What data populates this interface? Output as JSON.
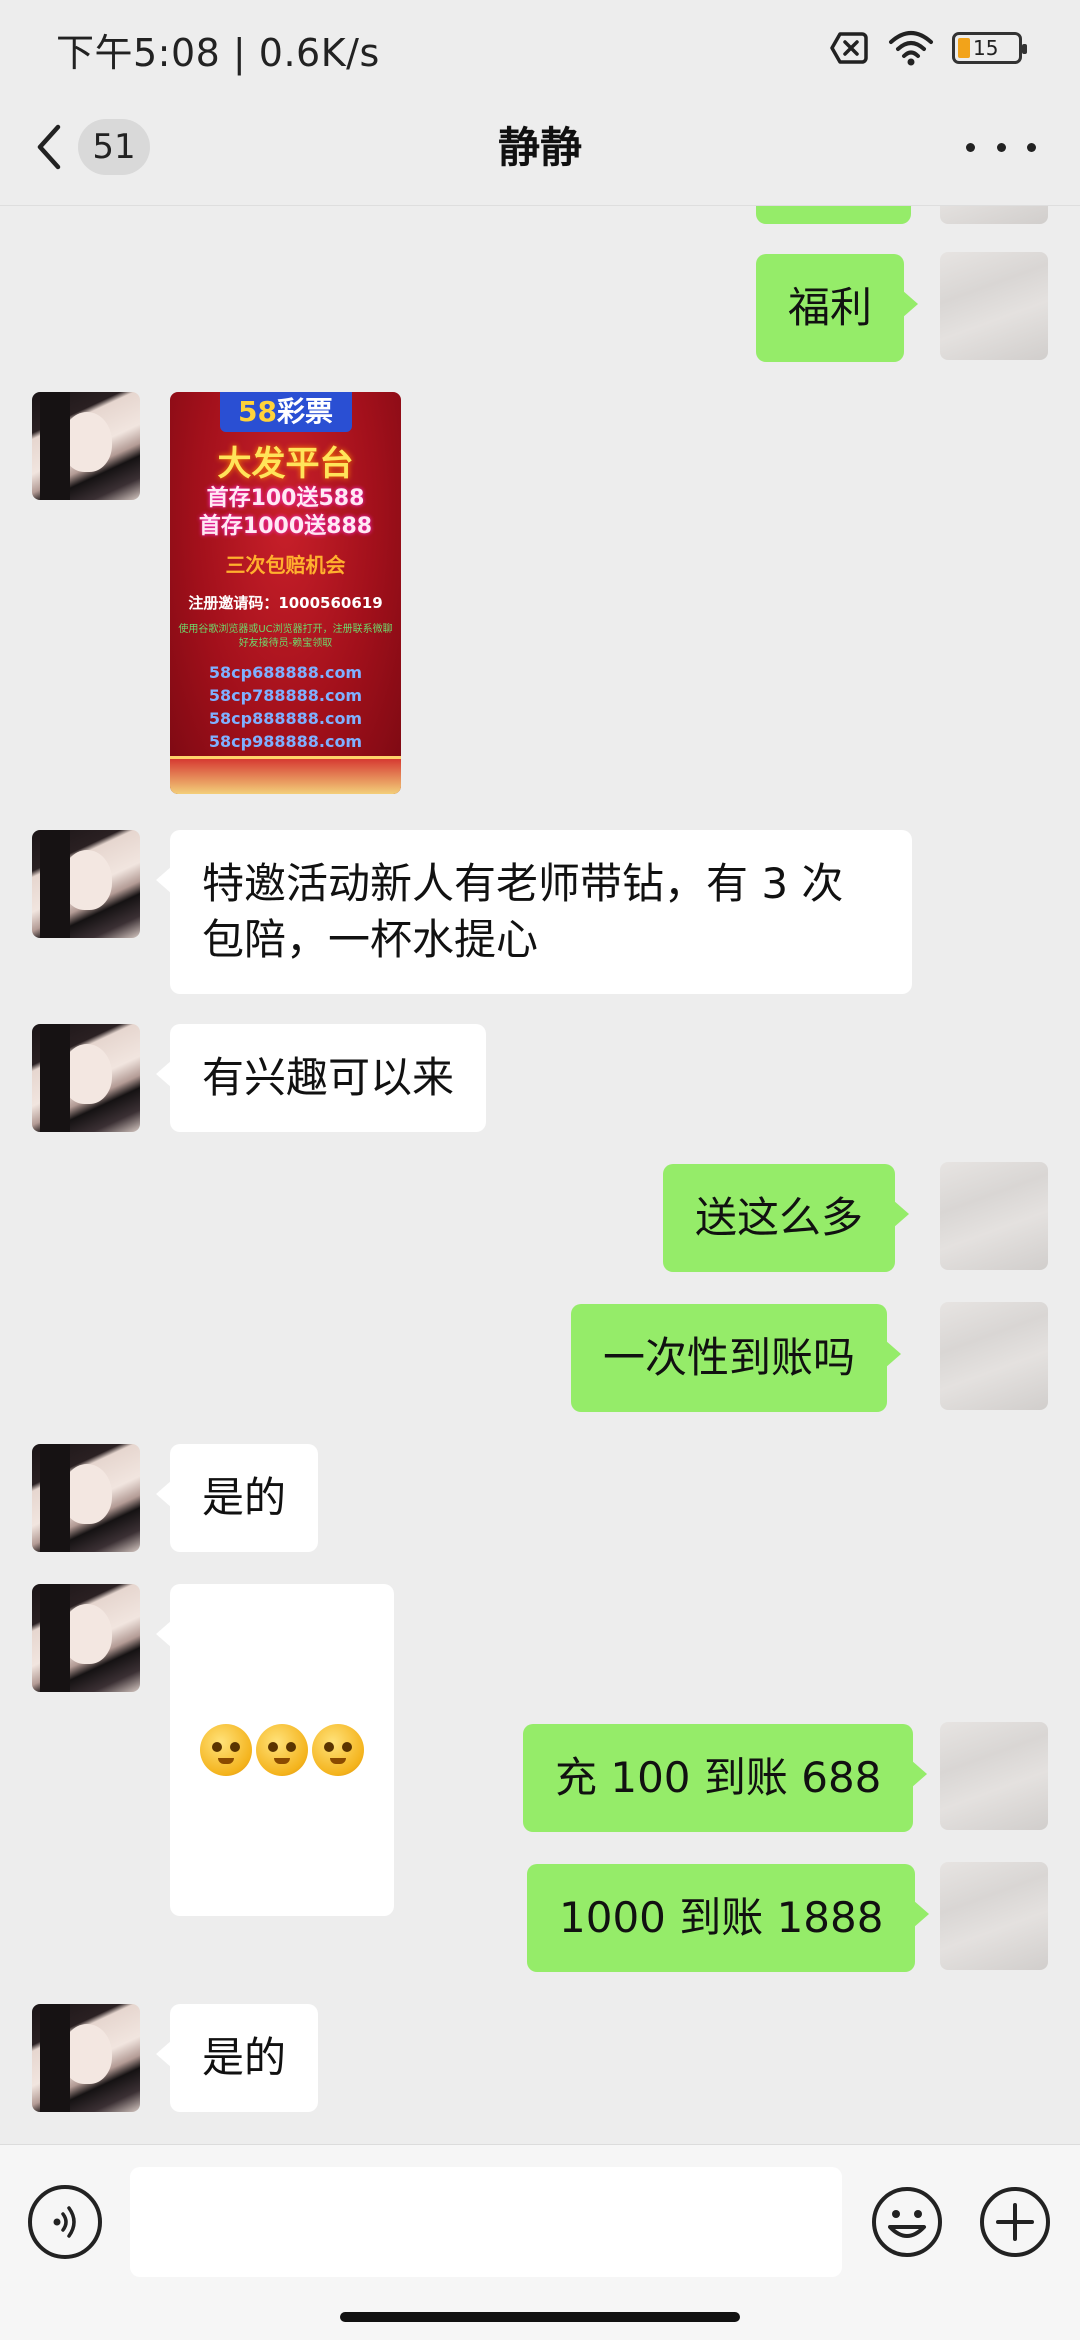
{
  "status_bar": {
    "time": "下午5:08 | 0.6K/s",
    "battery": "15",
    "icons": [
      "no-sim-icon",
      "wifi-icon",
      "battery-icon"
    ]
  },
  "nav": {
    "unread_count": "51",
    "title": "静静",
    "icons": [
      "back-chevron-icon",
      "more-dots-icon"
    ]
  },
  "messages": [
    {
      "from": "me",
      "text": ""
    },
    {
      "from": "me",
      "text": "福利"
    },
    {
      "from": "her",
      "type": "image",
      "ad": {
        "logo_num": "58",
        "logo_text": "彩票",
        "headline": "大发平台",
        "line1": "首存100送588",
        "line2": "首存1000送888",
        "chance": "三次包赔机会",
        "invite": "注册邀请码：1000560619",
        "note": "使用谷歌浏览器或UC浏览器打开，注册联系微聊好友接待员-赖宝领取",
        "urls": [
          "58cp688888.com",
          "58cp788888.com",
          "58cp888888.com",
          "58cp988888.com"
        ]
      }
    },
    {
      "from": "her",
      "text": "特邀活动新人有老师带钻，有 3 次\n包陪，一杯水提心"
    },
    {
      "from": "her",
      "text": "有兴趣可以来"
    },
    {
      "from": "me",
      "text": "送这么多"
    },
    {
      "from": "me",
      "text": "一次性到账吗"
    },
    {
      "from": "her",
      "text": "是的"
    },
    {
      "from": "her",
      "type": "emoji",
      "emojis": [
        "face-with-monocle-icon",
        "face-with-monocle-icon",
        "face-with-monocle-icon"
      ]
    },
    {
      "from": "me",
      "text": "充 100 到账 688"
    },
    {
      "from": "me",
      "text": "1000 到账 1888"
    },
    {
      "from": "her",
      "text": "是的"
    }
  ],
  "input_bar": {
    "placeholder": "",
    "icons": [
      "voice-icon",
      "emoji-icon",
      "plus-icon"
    ]
  },
  "colors": {
    "background": "#ededed",
    "my_bubble": "#95ec69",
    "her_bubble": "#ffffff"
  }
}
